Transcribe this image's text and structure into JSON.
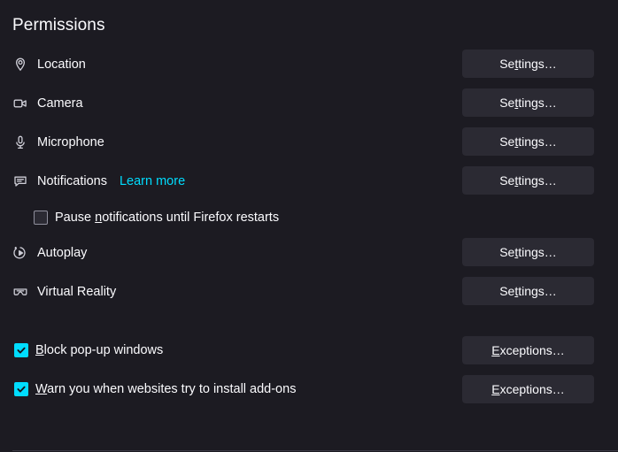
{
  "section": {
    "title": "Permissions"
  },
  "colors": {
    "background": "#1c1b22",
    "text": "#fbfbfe",
    "accent": "#00ddff",
    "button_bg": "#2b2a33",
    "divider": "#3a3944",
    "icon": "#cfcfd8"
  },
  "permissions": [
    {
      "icon": "location-pin-icon",
      "label": "Location",
      "button": {
        "prefix": "Se",
        "accesskey": "t",
        "suffix": "tings…",
        "full": "Settings…"
      }
    },
    {
      "icon": "camera-icon",
      "label": "Camera",
      "button": {
        "prefix": "Se",
        "accesskey": "t",
        "suffix": "tings…",
        "full": "Settings…"
      }
    },
    {
      "icon": "microphone-icon",
      "label": "Microphone",
      "button": {
        "prefix": "Se",
        "accesskey": "t",
        "suffix": "tings…",
        "full": "Settings…"
      }
    },
    {
      "icon": "notification-bubble-icon",
      "label": "Notifications",
      "link": "Learn more",
      "button": {
        "prefix": "Se",
        "accesskey": "t",
        "suffix": "tings…",
        "full": "Settings…"
      }
    },
    {
      "icon": "autoplay-icon",
      "label": "Autoplay",
      "button": {
        "prefix": "Se",
        "accesskey": "t",
        "suffix": "tings…",
        "full": "Settings…"
      }
    },
    {
      "icon": "virtual-reality-icon",
      "label": "Virtual Reality",
      "button": {
        "prefix": "Se",
        "accesskey": "t",
        "suffix": "tings…",
        "full": "Settings…"
      }
    }
  ],
  "pause_notifications": {
    "checked": false,
    "prefix": "Pause ",
    "accesskey": "n",
    "suffix": "otifications until Firefox restarts",
    "full": "Pause notifications until Firefox restarts"
  },
  "options": [
    {
      "checked": true,
      "prefix": "",
      "accesskey": "B",
      "suffix": "lock pop-up windows",
      "full": "Block pop-up windows",
      "button": {
        "prefix": "",
        "accesskey": "E",
        "suffix": "xceptions…",
        "full": "Exceptions…"
      }
    },
    {
      "checked": true,
      "prefix": "",
      "accesskey": "W",
      "suffix": "arn you when websites try to install add-ons",
      "full": "Warn you when websites try to install add-ons",
      "button": {
        "prefix": "",
        "accesskey": "E",
        "suffix": "xceptions…",
        "full": "Exceptions…"
      }
    }
  ]
}
